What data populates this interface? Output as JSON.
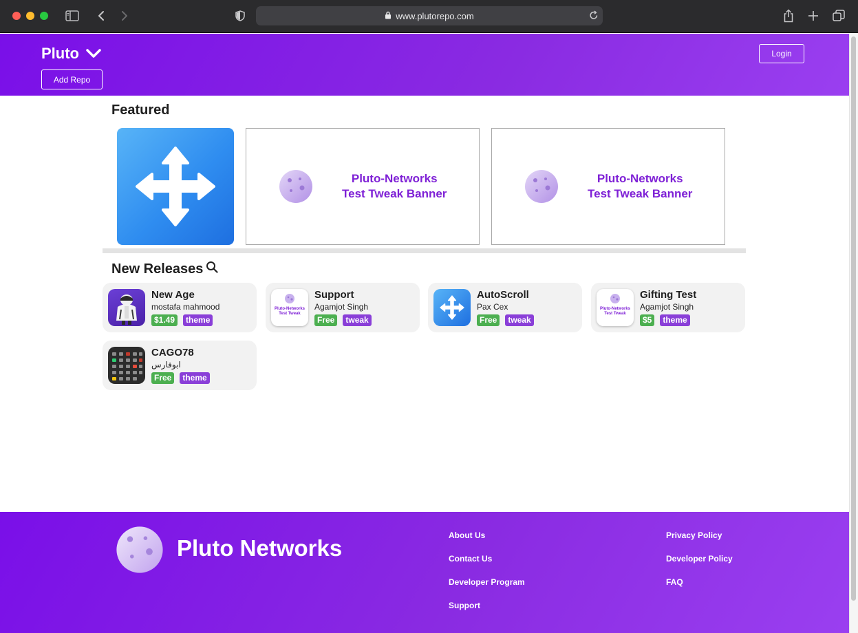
{
  "browser": {
    "url": "www.plutorepo.com"
  },
  "header": {
    "brand": "Pluto",
    "add_repo_label": "Add Repo",
    "login_label": "Login"
  },
  "featured": {
    "title": "Featured",
    "banners": [
      {
        "line1": "Pluto-Networks",
        "line2": "Test Tweak Banner"
      },
      {
        "line1": "Pluto-Networks",
        "line2": "Test Tweak Banner"
      }
    ]
  },
  "new_releases": {
    "title": "New Releases",
    "items": [
      {
        "name": "New Age",
        "author": "mostafa mahmood",
        "price": "$1.49",
        "type": "theme",
        "icon": "hoodie-figure-icon"
      },
      {
        "name": "Support",
        "author": "Agamjot Singh",
        "price": "Free",
        "type": "tweak",
        "icon": "pluto-banner-icon",
        "icon_line1": "Pluto-Networks",
        "icon_line2": "Test Tweak"
      },
      {
        "name": "AutoScroll",
        "author": "Pax Cex",
        "price": "Free",
        "type": "tweak",
        "icon": "move-arrows-icon"
      },
      {
        "name": "Gifting Test",
        "author": "Agamjot Singh",
        "price": "$5",
        "type": "theme",
        "icon": "pluto-banner-icon",
        "icon_line1": "Pluto-Networks",
        "icon_line2": "Test Tweak"
      },
      {
        "name": "CAGO78",
        "author": "ابوفارس",
        "price": "Free",
        "type": "theme",
        "icon": "icon-grid-icon"
      }
    ]
  },
  "footer": {
    "brand": "Pluto Networks",
    "links_col1": [
      "About Us",
      "Contact Us",
      "Developer Program",
      "Support"
    ],
    "links_col2": [
      "Privacy Policy",
      "Developer Policy",
      "FAQ"
    ]
  },
  "colors": {
    "brand_purple": "#8a2be2",
    "tag_green": "#4caf50",
    "tag_purple": "#8a3fd8",
    "banner_text": "#7f21d6"
  }
}
